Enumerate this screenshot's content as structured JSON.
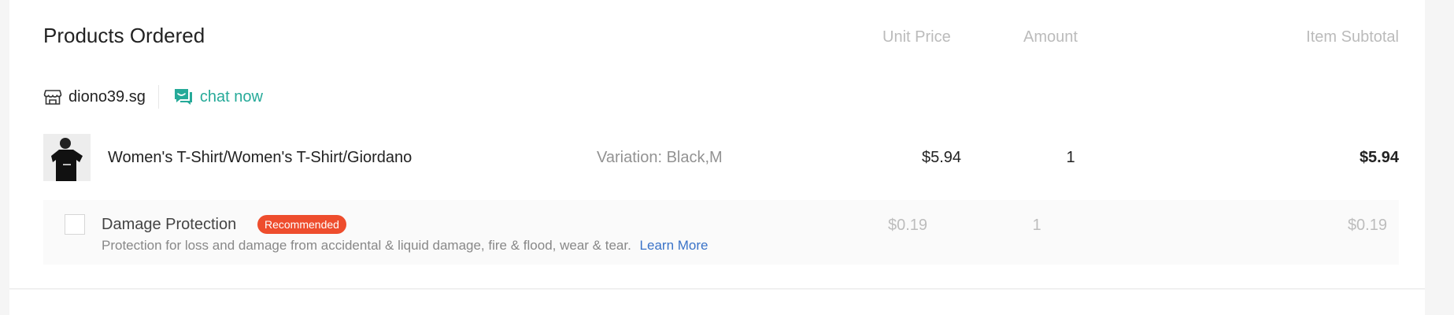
{
  "header": {
    "title": "Products Ordered",
    "col_unit_price": "Unit Price",
    "col_amount": "Amount",
    "col_item_subtotal": "Item Subtotal"
  },
  "shop": {
    "name": "diono39.sg",
    "icon": "store-icon",
    "chat_label": "chat now",
    "chat_icon": "chat-bubbles-icon",
    "accent_color": "#26aa99"
  },
  "product": {
    "name": "Women's T-Shirt/Women's T-Shirt/Giordano",
    "variation": "Variation: Black,M",
    "unit_price": "$5.94",
    "amount": "1",
    "subtotal": "$5.94"
  },
  "protection": {
    "title": "Damage Protection",
    "badge": "Recommended",
    "badge_color": "#ee4d2d",
    "description": "Protection for loss and damage from accidental & liquid damage, fire & flood, wear & tear.",
    "learn_more": "Learn More",
    "unit_price": "$0.19",
    "amount": "1",
    "subtotal": "$0.19",
    "checked": false
  }
}
